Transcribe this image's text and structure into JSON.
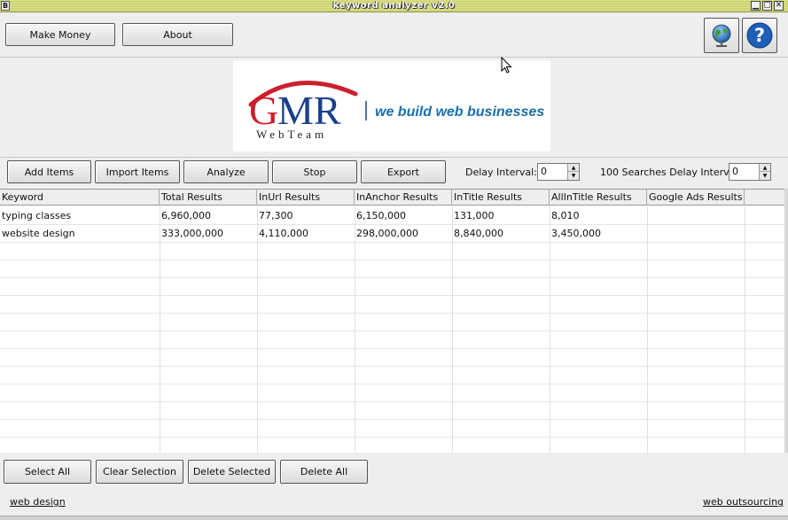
{
  "window": {
    "title": "keyword analyzer v2.0",
    "controls": {
      "system": "B",
      "minimize": "▁",
      "maximize": "▢",
      "close": "✕"
    }
  },
  "header": {
    "make_money_label": "Make Money",
    "about_label": "About",
    "globe_icon": "globe-icon",
    "help_icon": "help-icon"
  },
  "logo": {
    "brand": "GMR",
    "subbrand": "WebTeam",
    "tagline": "we build web businesses",
    "colors": {
      "brand": "#1a3f8a",
      "accent": "#cc1f2e",
      "tagline": "#1a6fae"
    }
  },
  "toolbar": {
    "add_items": "Add Items",
    "import_items": "Import Items",
    "analyze": "Analyze",
    "stop": "Stop",
    "export": "Export",
    "delay_label": "Delay Interval:",
    "delay_value": "0",
    "searches_delay_label": "100 Searches Delay Interval:",
    "searches_delay_value": "0"
  },
  "table": {
    "columns": [
      "Keyword",
      "Total Results",
      "InUrl Results",
      "InAnchor Results",
      "InTitle Results",
      "AllInTitle Results",
      "Google Ads Results"
    ],
    "rows": [
      [
        "typing classes",
        "6,960,000",
        "77,300",
        "6,150,000",
        "131,000",
        "8,010",
        ""
      ],
      [
        "website design",
        "333,000,000",
        "4,110,000",
        "298,000,000",
        "8,840,000",
        "3,450,000",
        ""
      ]
    ]
  },
  "actions": {
    "select_all": "Select All",
    "clear_selection": "Clear Selection",
    "delete_selected": "Delete Selected",
    "delete_all": "Delete All"
  },
  "footer": {
    "left_link": "web design",
    "right_link": "web outsourcing"
  }
}
